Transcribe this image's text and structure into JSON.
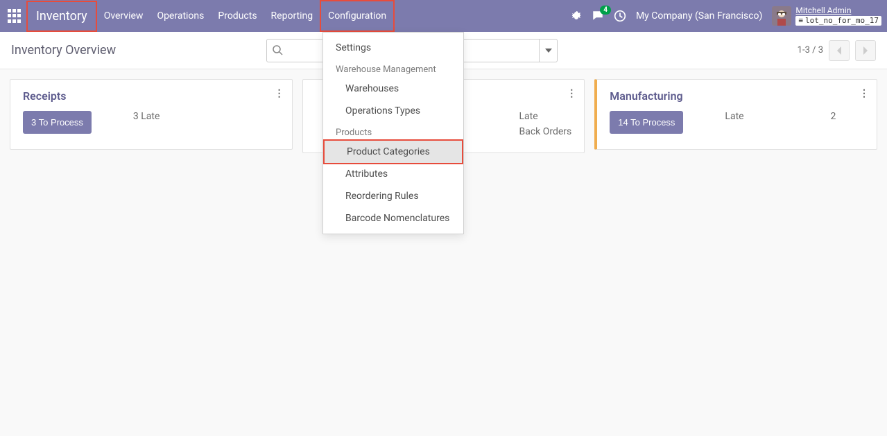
{
  "nav": {
    "brand": "Inventory",
    "items": [
      "Overview",
      "Operations",
      "Products",
      "Reporting",
      "Configuration"
    ],
    "conversations_count": "4",
    "company": "My Company (San Francisco)",
    "user_name": "Mitchell Admin",
    "db_name": "lot_no_for_mo_17"
  },
  "breadcrumb": {
    "title": "Inventory Overview"
  },
  "search": {
    "placeholder": ""
  },
  "pager": {
    "text": "1-3 / 3"
  },
  "dropdown": {
    "settings": "Settings",
    "section_wm": "Warehouse Management",
    "warehouses": "Warehouses",
    "op_types": "Operations Types",
    "section_products": "Products",
    "product_categories": "Product Categories",
    "attributes": "Attributes",
    "reorder": "Reordering Rules",
    "barcode": "Barcode Nomenclatures"
  },
  "cards": {
    "receipts": {
      "title": "Receipts",
      "button": "3 To Process",
      "late_label": "3 Late"
    },
    "delivery": {
      "late_label": "Late",
      "back_orders": "Back Orders"
    },
    "manufacturing": {
      "title": "Manufacturing",
      "button": "14 To Process",
      "late_label": "Late",
      "late_value": "2"
    }
  }
}
